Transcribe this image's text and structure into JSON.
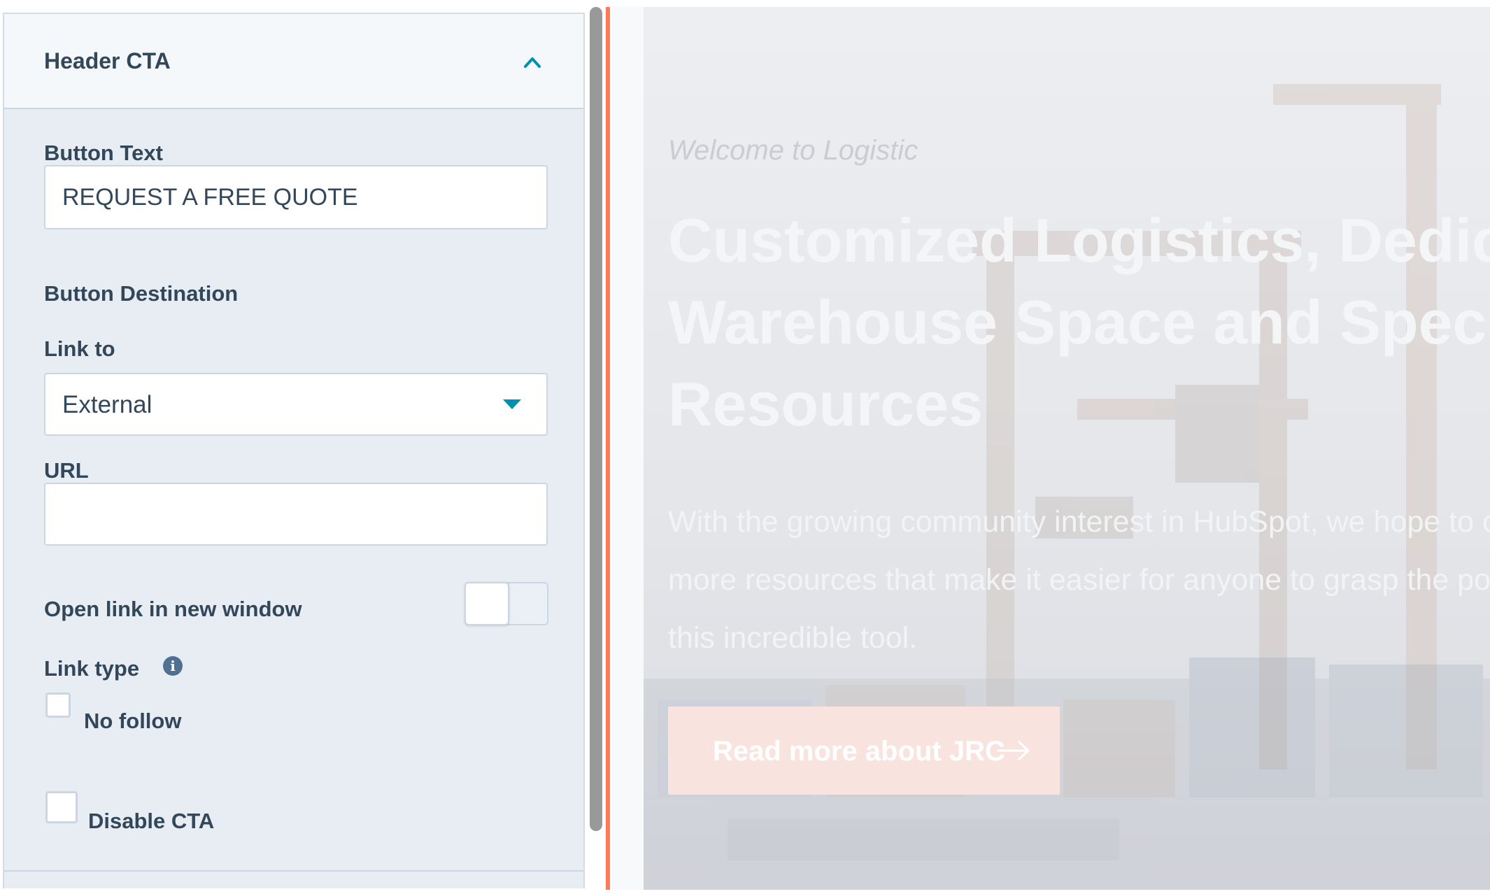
{
  "panel": {
    "section_title": "Header CTA",
    "button_text_label": "Button Text",
    "button_text_value": "REQUEST A FREE QUOTE",
    "button_destination_label": "Button Destination",
    "link_to_label": "Link to",
    "link_to_value": "External",
    "url_label": "URL",
    "url_value": "",
    "open_new_window_label": "Open link in new window",
    "open_new_window_on": false,
    "link_type_label": "Link type",
    "no_follow_label": "No follow",
    "no_follow_checked": false,
    "disable_cta_label": "Disable CTA",
    "disable_cta_checked": false
  },
  "preview": {
    "welcome": "Welcome to Logistic",
    "title_lines": [
      "Customized Logistics, Dedicated",
      "Warehouse Space and Specialized",
      "Resources"
    ],
    "description_lines": [
      "With the growing community interest in HubSpot, we hope to create",
      "more resources that make it easier for anyone to grasp the power of",
      "this incredible tool."
    ],
    "button_label": "Read more about JRC"
  },
  "colors": {
    "accent_orange": "#ff7a59",
    "caret_teal": "#0091ae",
    "label_text": "#33475b",
    "panel_bg": "#e8edf4"
  },
  "icons": {
    "collapse": "chevron-up-icon",
    "dropdown": "caret-down-icon",
    "info": "info-icon",
    "cta_arrow": "arrow-right-icon"
  }
}
